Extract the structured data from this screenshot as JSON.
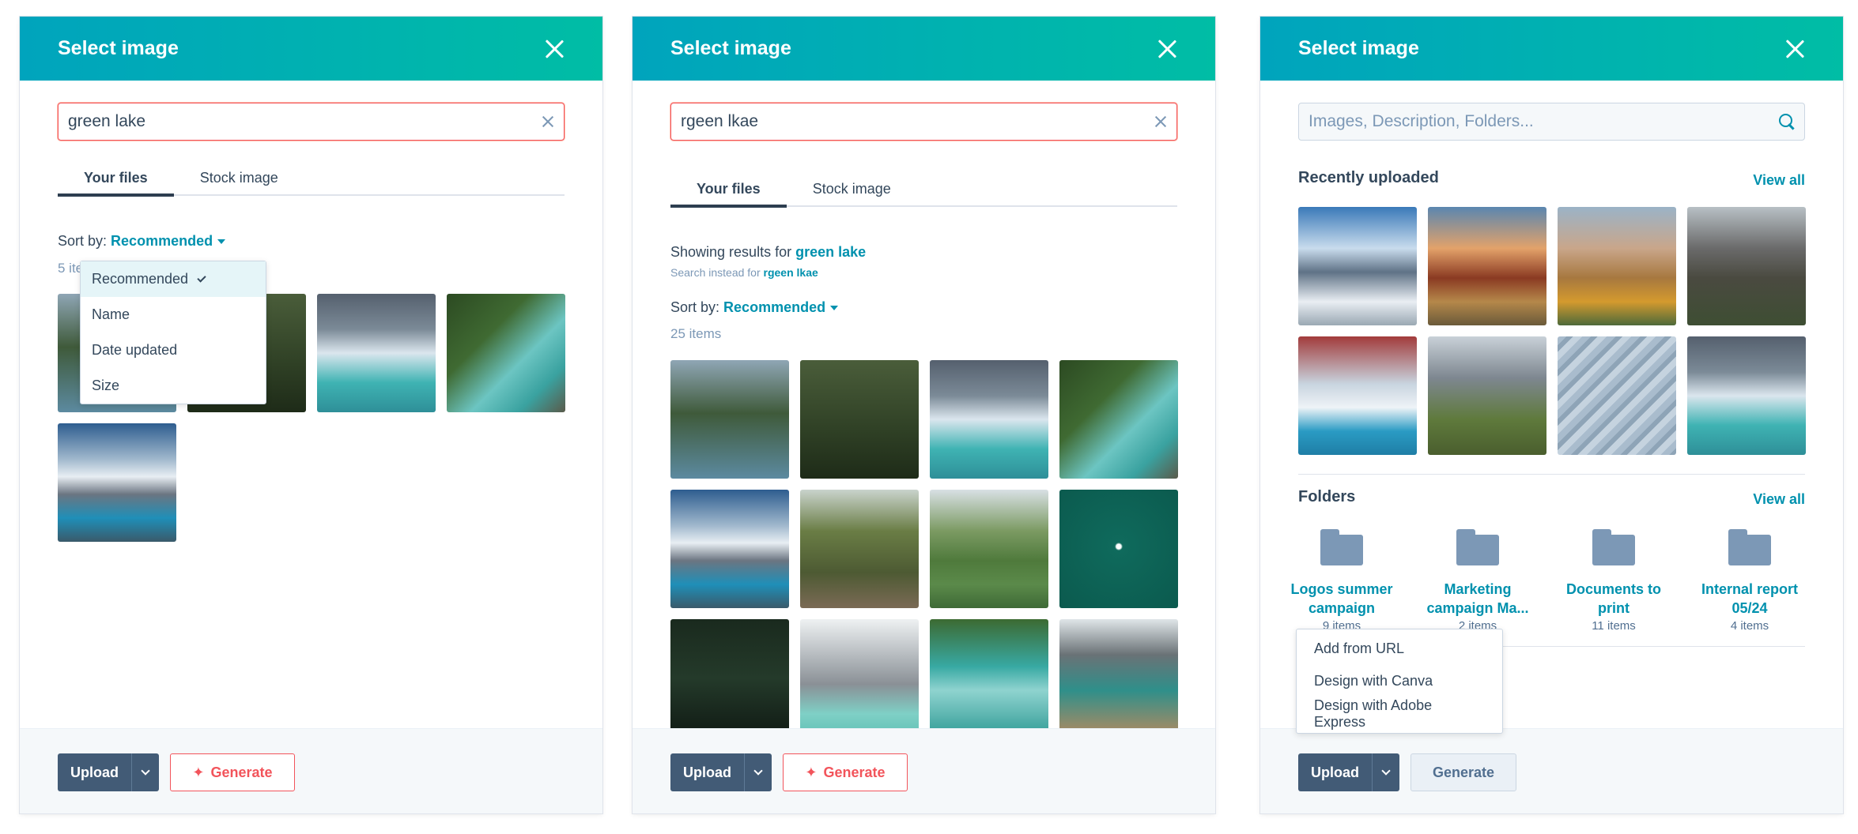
{
  "panels": [
    {
      "title": "Select image",
      "search": {
        "value": "green lake"
      },
      "tabs": [
        "Your files",
        "Stock image"
      ],
      "sort": {
        "label": "Sort by:",
        "value": "Recommended"
      },
      "count": "5 items",
      "sort_menu": [
        "Recommended",
        "Name",
        "Date updated",
        "Size"
      ],
      "footer": {
        "upload": "Upload",
        "generate": "Generate"
      }
    },
    {
      "title": "Select image",
      "search": {
        "value": "rgeen lkae"
      },
      "tabs": [
        "Your files",
        "Stock image"
      ],
      "results": {
        "prefix": "Showing results for",
        "term": "green lake",
        "instead_prefix": "Search instead for",
        "instead_term": "rgeen lkae"
      },
      "sort": {
        "label": "Sort by:",
        "value": "Recommended"
      },
      "count": "25 items",
      "footer": {
        "upload": "Upload",
        "generate": "Generate"
      }
    },
    {
      "title": "Select image",
      "search": {
        "placeholder": "Images, Description, Folders..."
      },
      "recent": {
        "title": "Recently uploaded",
        "view_all": "View all"
      },
      "folders": {
        "title": "Folders",
        "view_all": "View all",
        "items": [
          {
            "name": [
              "Logos summer",
              "campaign"
            ],
            "count": "9 items"
          },
          {
            "name": [
              "Marketing",
              "campaign Ma..."
            ],
            "count": "2 items"
          },
          {
            "name": [
              "Documents to",
              "print"
            ],
            "count": "11 items"
          },
          {
            "name": [
              "Internal report",
              "05/24"
            ],
            "count": "4 items"
          }
        ]
      },
      "upload_menu": [
        "Add from URL",
        "Design with Canva",
        "Design with Adobe Express"
      ],
      "footer": {
        "upload": "Upload",
        "generate": "Generate"
      }
    }
  ],
  "colors": {
    "header_start": "#00a4bd",
    "header_end": "#00bda5",
    "link": "#0091ae",
    "generate": "#f2545b",
    "button_dark": "#425b76"
  }
}
